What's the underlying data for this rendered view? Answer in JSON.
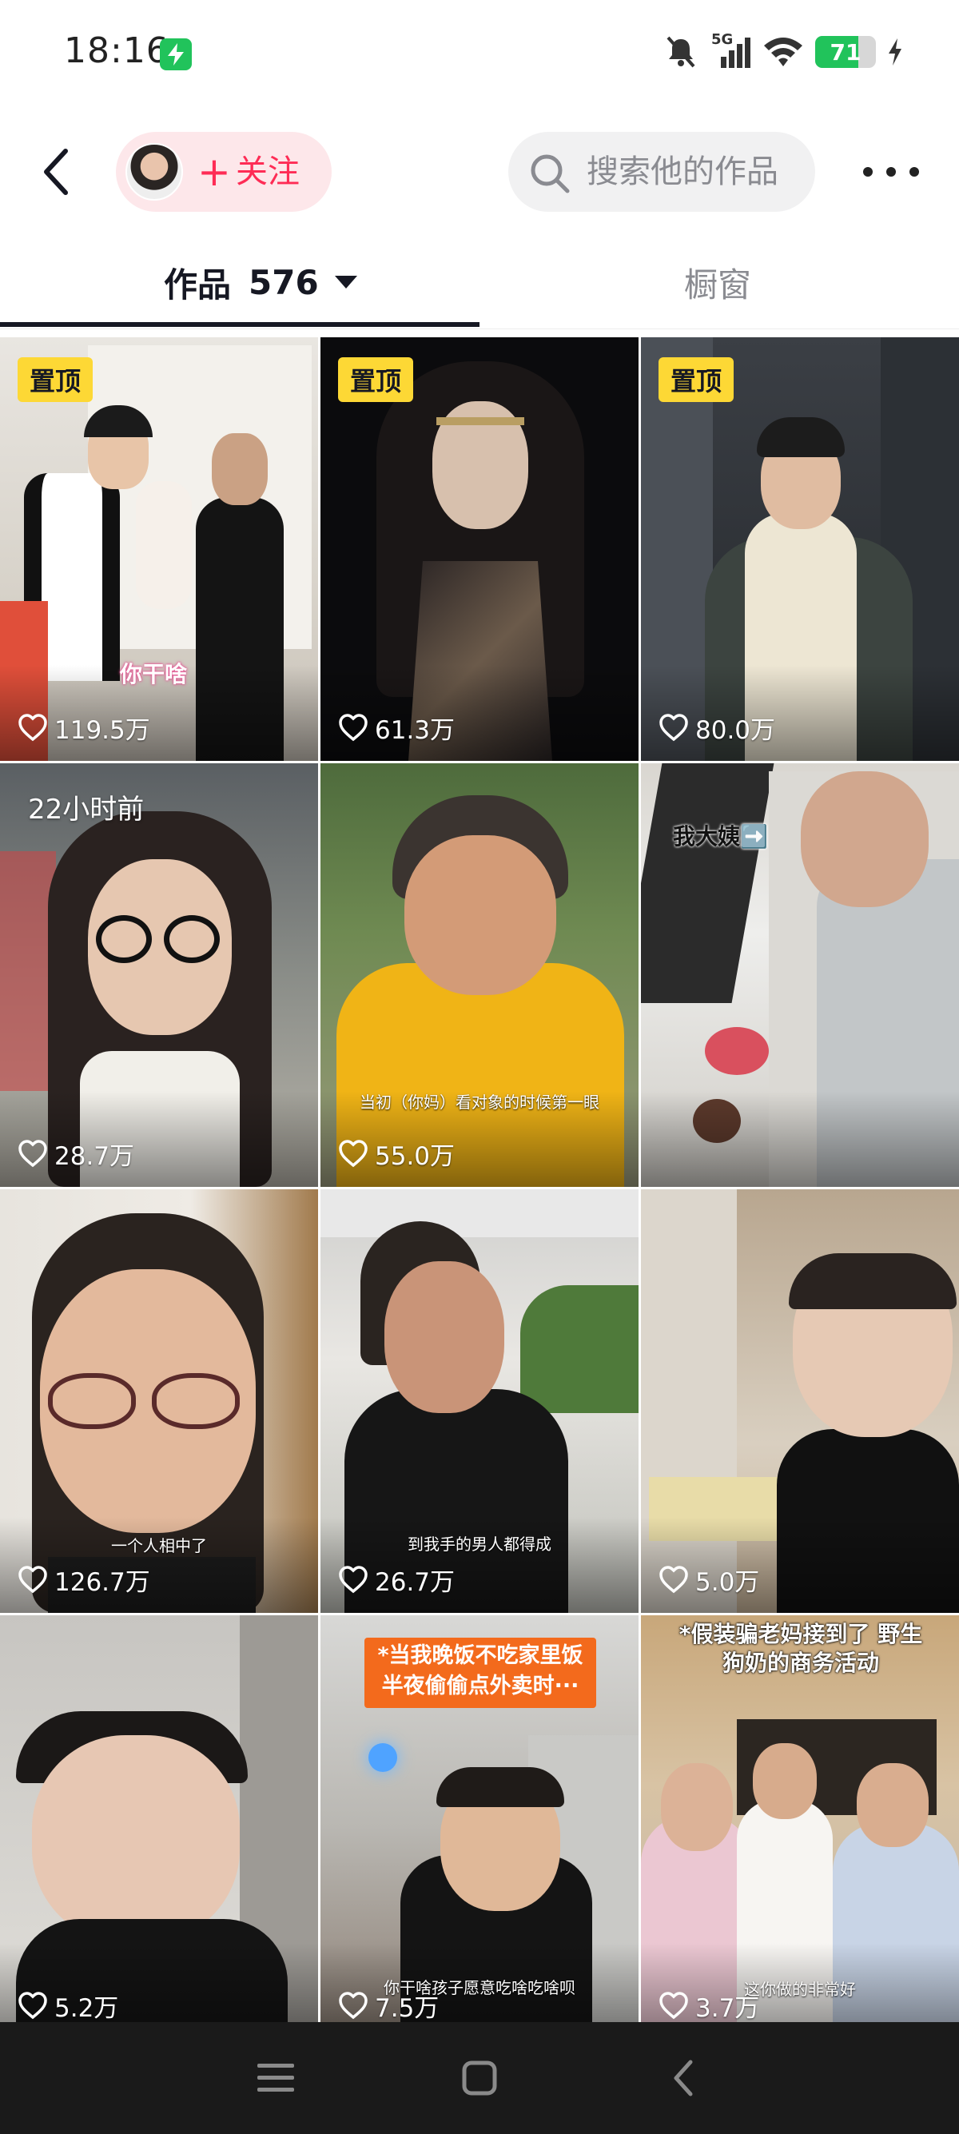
{
  "status_bar": {
    "time": "18:16",
    "network": "5G",
    "battery": "71",
    "battery_level": 0.71,
    "icons": [
      "charging-bolt-icon",
      "mute-bell-icon",
      "signal-icon",
      "wifi-icon",
      "battery-icon"
    ]
  },
  "top_nav": {
    "follow_label": "关注",
    "search_placeholder": "搜索他的作品",
    "icons": [
      "back-arrow-icon",
      "plus-icon",
      "search-icon",
      "more-icon"
    ]
  },
  "tabs": {
    "works_label": "作品",
    "works_count": "576",
    "shop_label": "橱窗"
  },
  "grid": [
    {
      "pinned": true,
      "pin_label": "置顶",
      "likes": "119.5万",
      "overlay_text": "你干啥",
      "time_label": null
    },
    {
      "pinned": true,
      "pin_label": "置顶",
      "likes": "61.3万",
      "overlay_text": null,
      "time_label": null
    },
    {
      "pinned": true,
      "pin_label": "置顶",
      "likes": "80.0万",
      "overlay_text": null,
      "time_label": null
    },
    {
      "pinned": false,
      "likes": "28.7万",
      "overlay_text": null,
      "time_label": "22小时前"
    },
    {
      "pinned": false,
      "likes": "55.0万",
      "overlay_text": "当初（你妈）看对象的时候第一眼",
      "time_label": null
    },
    {
      "pinned": false,
      "likes": "",
      "overlay_text": "我大姨➡️",
      "time_label": null
    },
    {
      "pinned": false,
      "likes": "126.7万",
      "overlay_text": "一个人相中了",
      "time_label": null
    },
    {
      "pinned": false,
      "likes": "26.7万",
      "overlay_text": "到我手的男人都得成",
      "time_label": null
    },
    {
      "pinned": false,
      "likes": "5.0万",
      "overlay_text": null,
      "time_label": null
    },
    {
      "pinned": false,
      "likes": "5.2万",
      "overlay_text": null,
      "time_label": null
    },
    {
      "pinned": false,
      "likes": "7.5万",
      "overlay_text": "*当我晚饭不吃家里饭 半夜偷偷点外卖时···",
      "subtitle": "你干啥孩子愿意吃啥吃啥呗",
      "time_label": null
    },
    {
      "pinned": false,
      "likes": "3.7万",
      "overlay_text": "*假装骗老妈接到了 野生狗奶的商务活动",
      "subtitle": "这你做的非常好",
      "time_label": null
    }
  ],
  "nav_bar": {
    "icons": [
      "menu-icon",
      "home-icon",
      "back-icon"
    ]
  },
  "colors": {
    "accent": "#fe2c55",
    "follow_bg": "#fde7ea",
    "pin_badge": "#fdd835",
    "battery_green": "#21c35b",
    "nav_bg": "#1a1a1a"
  }
}
